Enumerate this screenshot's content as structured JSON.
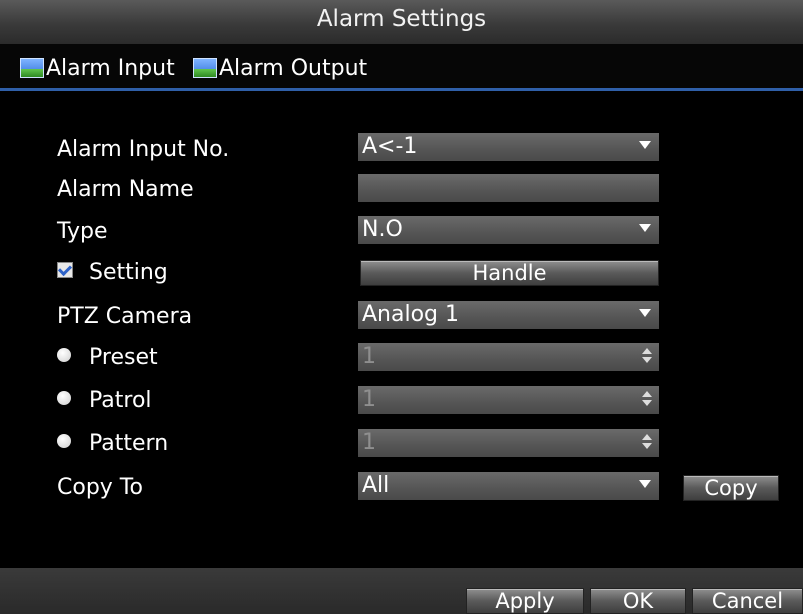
{
  "window": {
    "title": "Alarm Settings"
  },
  "tabs": [
    {
      "label": "Alarm Input",
      "icon": "image-icon"
    },
    {
      "label": "Alarm Output",
      "icon": "image-icon"
    }
  ],
  "form": {
    "alarm_input_no": {
      "label": "Alarm Input No.",
      "value": "A<-1"
    },
    "alarm_name": {
      "label": "Alarm Name",
      "value": ""
    },
    "type": {
      "label": "Type",
      "value": "N.O"
    },
    "setting": {
      "label": "Setting",
      "checked": true,
      "button": "Handle"
    },
    "ptz_camera": {
      "label": "PTZ Camera",
      "value": "Analog 1"
    },
    "preset": {
      "label": "Preset",
      "value": "1"
    },
    "patrol": {
      "label": "Patrol",
      "value": "1"
    },
    "pattern": {
      "label": "Pattern",
      "value": "1"
    },
    "copy_to": {
      "label": "Copy To",
      "value": "All",
      "button": "Copy"
    }
  },
  "footer": {
    "apply": "Apply",
    "ok": "OK",
    "cancel": "Cancel"
  },
  "colors": {
    "accent": "#2f5fa8",
    "background": "#000000",
    "field": "#5a5a5a"
  }
}
